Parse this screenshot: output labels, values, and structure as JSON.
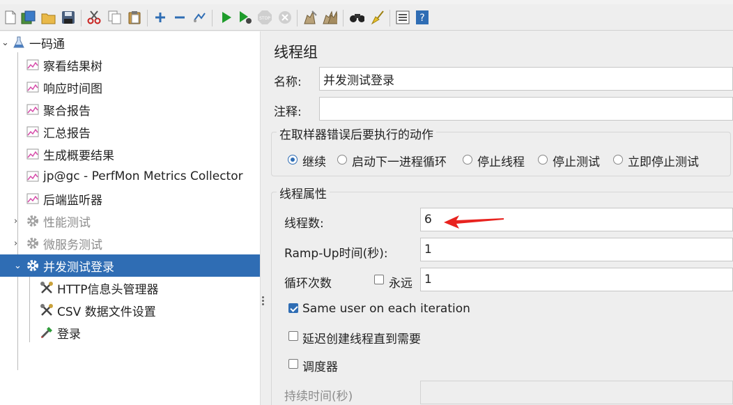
{
  "tree": {
    "root": "一码通",
    "listeners": [
      "察看结果树",
      "响应时间图",
      "聚合报告",
      "汇总报告",
      "生成概要结果",
      "jp@gc - PerfMon Metrics Collector",
      "后端监听器"
    ],
    "groups": [
      "性能测试",
      "微服务测试",
      "并发测试登录"
    ],
    "children": [
      "HTTP信息头管理器",
      "CSV 数据文件设置",
      "登录"
    ]
  },
  "panel": {
    "title": "线程组",
    "name_label": "名称:",
    "name_value": "并发测试登录",
    "comment_label": "注释:",
    "comment_value": "",
    "on_error_title": "在取样器错误后要执行的动作",
    "on_error_options": [
      "继续",
      "启动下一进程循环",
      "停止线程",
      "停止测试",
      "立即停止测试"
    ],
    "on_error_selected": "继续",
    "thread_props_title": "线程属性",
    "threads_label": "线程数:",
    "threads_value": "6",
    "rampup_label": "Ramp-Up时间(秒):",
    "rampup_value": "1",
    "loop_label": "循环次数",
    "forever_label": "永远",
    "forever_checked": false,
    "loop_value": "1",
    "same_user_label": "Same user on each iteration",
    "same_user_checked": true,
    "delay_label": "延迟创建线程直到需要",
    "delay_checked": false,
    "scheduler_label": "调度器",
    "scheduler_checked": false,
    "duration_label": "持续时间(秒)",
    "duration_value": ""
  },
  "colors": {
    "selection": "#2f6db4",
    "annotation_arrow": "#e8231f"
  },
  "icons": {
    "toolbar": [
      "new-icon",
      "templates-icon",
      "open-icon",
      "save-icon",
      "cut-icon",
      "copy-icon",
      "paste-icon",
      "expand-icon",
      "collapse-icon",
      "toggle-icon",
      "start-icon",
      "start-no-pause-icon",
      "stop-icon",
      "shutdown-icon",
      "clear-icon",
      "clear-all-icon",
      "search-icon",
      "reset-search-icon",
      "function-helper-icon",
      "help-icon"
    ]
  }
}
